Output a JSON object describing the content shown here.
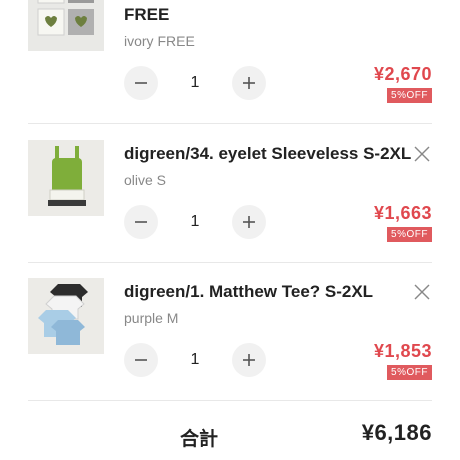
{
  "cart": {
    "items": [
      {
        "name": "FREE",
        "variant": "ivory FREE",
        "quantity": "1",
        "price": "¥2,670",
        "discount": "5%OFF"
      },
      {
        "name": "digreen/34. eyelet Sleeveless S-2XL",
        "variant": "olive S",
        "quantity": "1",
        "price": "¥1,663",
        "discount": "5%OFF"
      },
      {
        "name": "digreen/1. Matthew Tee? S-2XL",
        "variant": "purple M",
        "quantity": "1",
        "price": "¥1,853",
        "discount": "5%OFF"
      }
    ]
  },
  "summary": {
    "total_label": "合計",
    "total_value": "¥6,186"
  },
  "colors": {
    "price": "#e0484e",
    "badge": "#e05a5e",
    "stepper_bg": "#f1f1f1"
  },
  "icons": {
    "close": "close-icon",
    "minus": "minus-icon",
    "plus": "plus-icon"
  }
}
